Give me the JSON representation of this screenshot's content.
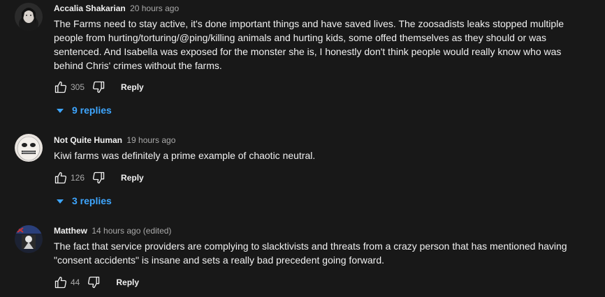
{
  "comments": [
    {
      "author": "Accalia Shakarian",
      "time": "20 hours ago",
      "text": "The Farms need to stay active, it's done important things and have saved lives. The zoosadists leaks stopped multiple people from hurting/torturing/@ping/killing animals and hurting kids, some offed themselves as they should or was sentenced. And Isabella was exposed for the monster she is, I honestly don't think people would really know who was behind Chris' crimes without the farms.",
      "likes": "305",
      "reply_label": "Reply",
      "replies": "9 replies"
    },
    {
      "author": "Not Quite Human",
      "time": "19 hours ago",
      "text": "Kiwi farms was definitely a prime example of chaotic neutral.",
      "likes": "126",
      "reply_label": "Reply",
      "replies": "3 replies"
    },
    {
      "author": "Matthew",
      "time": "14 hours ago (edited)",
      "text": "The fact that service providers are complying to slacktivists and threats from a crazy person that has mentioned having \"consent accidents\" is insane and sets a really bad precedent going forward.",
      "likes": "44",
      "reply_label": "Reply"
    }
  ],
  "icons": {
    "like": "thumbs-up-icon",
    "dislike": "thumbs-down-icon",
    "expand": "caret-down-icon"
  },
  "colors": {
    "background": "#181818",
    "text": "#f1f1f1",
    "secondary": "#aaaaaa",
    "link": "#3ea6ff"
  }
}
